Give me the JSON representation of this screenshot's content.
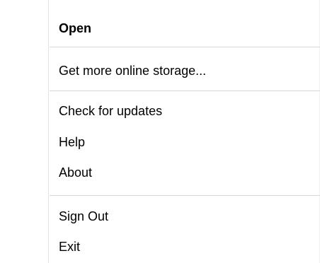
{
  "menu": {
    "items": [
      {
        "label": "Open",
        "bold": true
      },
      {
        "label": "Get more online storage..."
      },
      {
        "label": "Check for updates"
      },
      {
        "label": "Help"
      },
      {
        "label": "About"
      },
      {
        "label": "Sign Out"
      },
      {
        "label": "Exit"
      }
    ]
  }
}
